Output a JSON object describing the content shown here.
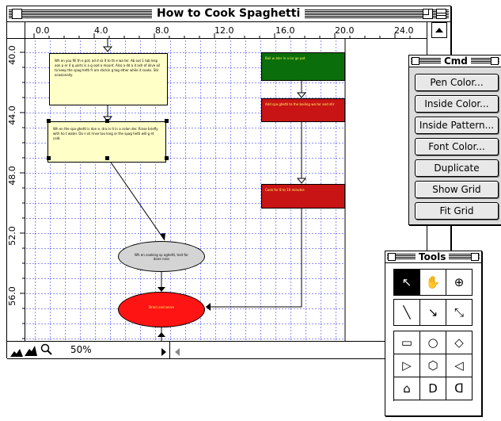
{
  "main_window": {
    "title": "How to Cook Spaghetti",
    "ruler_x": [
      "0.0",
      "4.0",
      "8.0",
      "12.0",
      "16.0",
      "20.0",
      "24.0"
    ],
    "ruler_y": [
      "40.0",
      "44.0",
      "48.0",
      "52.0",
      "56.0"
    ],
    "zoom": "50%",
    "grid_color": "#2020ff",
    "nodes": {
      "note1": "Wh en you fill th e pot, ad d sa lt to th e wa ter. Ab out 1 tab lesp oon p er 4 q uarts is a g ood a mount. Also a dd a d ash of olive oil to keep the spag hetti fr om stickin g tog ether while it cooks. Stir ocasionally.",
      "note2": "Wh en the spa ghetti is don e, dra in it in a colan der. Rinse briefly with ho t water. Do n ot rinse too long or the spag hetti will g et cold.",
      "green": "Boil w ater in a lar ge pot",
      "red1": "Add spa ghetti to the boiling wa ter and stir",
      "red2": "Cook for 8 to 10 minutes",
      "gray": "Wh en cooking sp aghetti, test for done ness",
      "redell": "Drain and serve"
    }
  },
  "cmd_palette": {
    "title": "Cmd",
    "buttons": [
      "Pen Color...",
      "Inside Color...",
      "Inside Pattern...",
      "Font Color...",
      "Duplicate",
      "Show Grid",
      "Fit Grid"
    ]
  },
  "tools_palette": {
    "title": "Tools",
    "tools": {
      "pointer": "↖",
      "hand": "✋",
      "zoom": "⊕",
      "line": "╲",
      "arrow_line": "↘",
      "double_arrow": "⤡",
      "rect": "▭",
      "circle": "○",
      "diamond": "◇",
      "pentagon_right": "▷",
      "shield": "⬡",
      "tag_left": "◁",
      "house": "⌂",
      "d_shape": "D",
      "c_shape": "ᗡ"
    }
  },
  "colors": {
    "note_fill": "#ffffc8",
    "green_node": "#0a6e0a",
    "red_node": "#c81414",
    "gray_node": "#d4d4d4",
    "red_ellipse": "#ff1414"
  }
}
